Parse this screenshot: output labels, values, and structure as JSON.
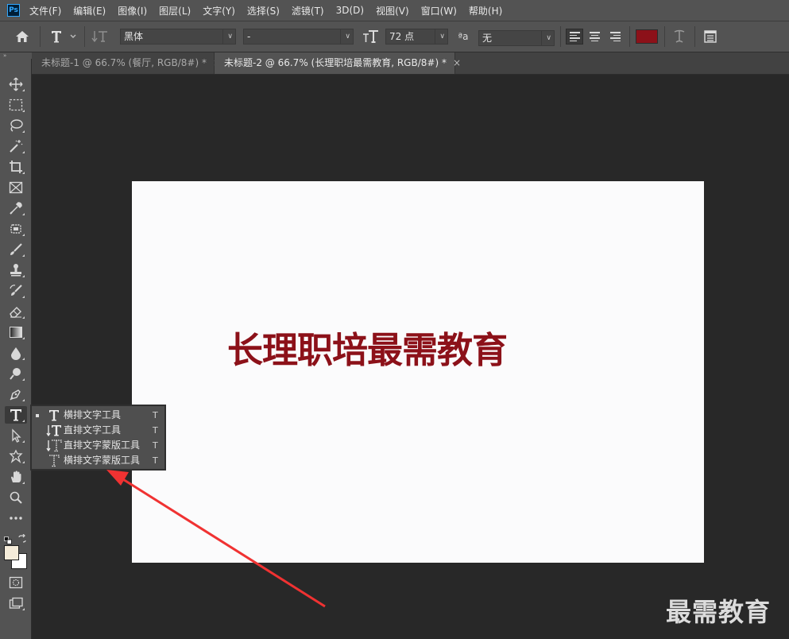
{
  "app": {
    "logo_text": "Ps"
  },
  "menu": [
    "文件(F)",
    "编辑(E)",
    "图像(I)",
    "图层(L)",
    "文字(Y)",
    "选择(S)",
    "滤镜(T)",
    "3D(D)",
    "视图(V)",
    "窗口(W)",
    "帮助(H)"
  ],
  "options": {
    "font_family": "黑体",
    "font_style": "-",
    "font_size": "72 点",
    "antialias": "无",
    "text_color": "#8c1119",
    "aa_glyph": "ªa"
  },
  "tabs": [
    {
      "label": "未标题-1 @ 66.7% (餐厅, RGB/8#) *",
      "close": "×",
      "active": false
    },
    {
      "label": "未标题-2 @ 66.7% (长理职培最需教育, RGB/8#) *",
      "close": "×",
      "active": true
    }
  ],
  "canvas": {
    "text": "长理职培最需教育",
    "text_color": "#8c1119"
  },
  "type_flyout": [
    {
      "label": "横排文字工具",
      "shortcut": "T",
      "selected": true,
      "icon": "horizontal-type-icon"
    },
    {
      "label": "直排文字工具",
      "shortcut": "T",
      "selected": false,
      "icon": "vertical-type-icon"
    },
    {
      "label": "直排文字蒙版工具",
      "shortcut": "T",
      "selected": false,
      "icon": "vertical-type-mask-icon"
    },
    {
      "label": "横排文字蒙版工具",
      "shortcut": "T",
      "selected": false,
      "icon": "horizontal-type-mask-icon"
    }
  ],
  "watermark": "最需教育",
  "colors": {
    "annotation_arrow": "#f03232",
    "foreground_swatch": "#f5ecd9",
    "background_swatch": "#ffffff"
  }
}
